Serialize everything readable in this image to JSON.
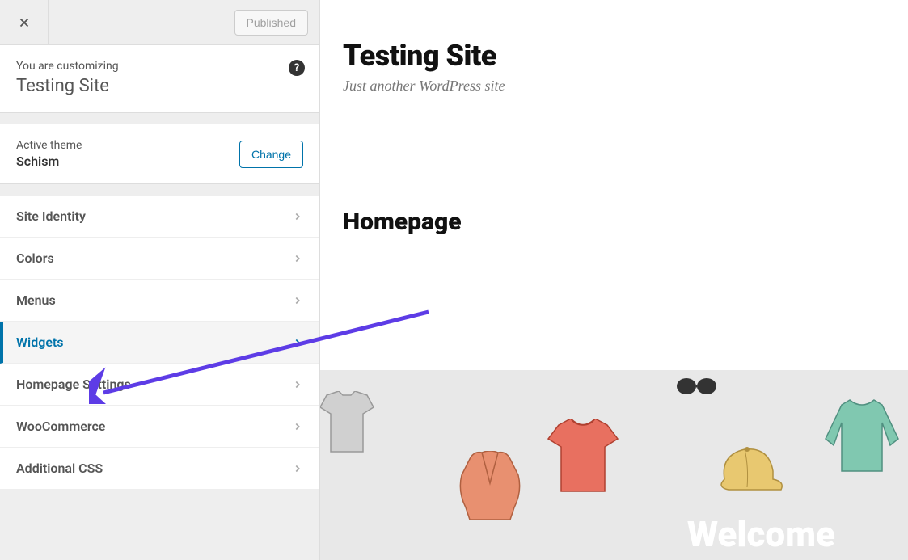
{
  "header": {
    "publish_status": "Published"
  },
  "customize": {
    "label": "You are customizing",
    "site_name": "Testing Site"
  },
  "theme": {
    "label": "Active theme",
    "name": "Schism",
    "change_label": "Change"
  },
  "nav": {
    "items": [
      {
        "label": "Site Identity",
        "active": false
      },
      {
        "label": "Colors",
        "active": false
      },
      {
        "label": "Menus",
        "active": false
      },
      {
        "label": "Widgets",
        "active": true
      },
      {
        "label": "Homepage Settings",
        "active": false
      },
      {
        "label": "WooCommerce",
        "active": false
      },
      {
        "label": "Additional CSS",
        "active": false
      }
    ]
  },
  "preview": {
    "site_title": "Testing Site",
    "tagline": "Just another WordPress site",
    "page_title": "Homepage",
    "hero_text": "Welcome"
  },
  "colors": {
    "accent": "#0073aa",
    "arrow": "#5d3ce6"
  }
}
